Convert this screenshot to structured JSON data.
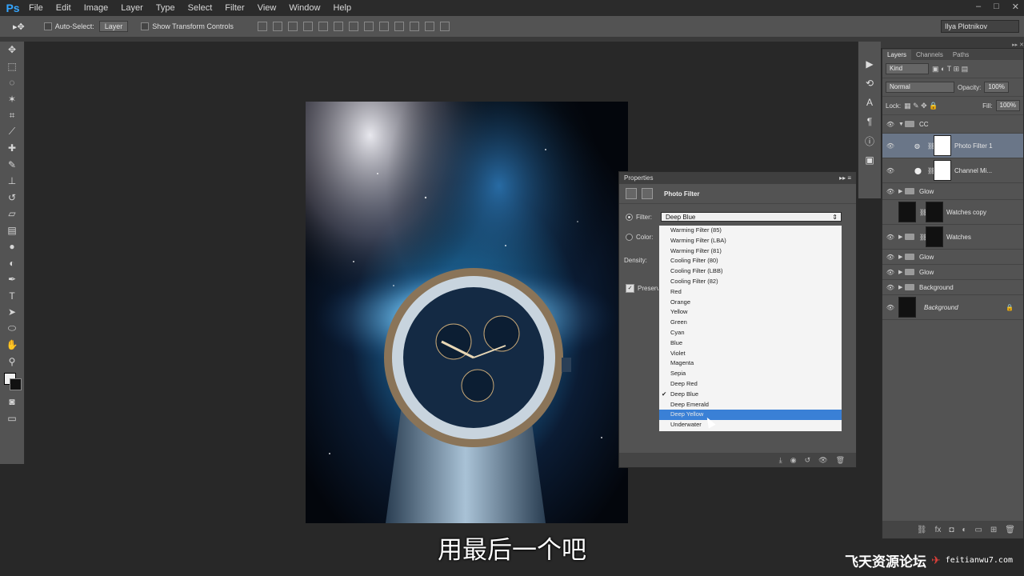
{
  "app": {
    "logo": "Ps"
  },
  "menu": [
    "File",
    "Edit",
    "Image",
    "Layer",
    "Type",
    "Select",
    "Filter",
    "View",
    "Window",
    "Help"
  ],
  "window_controls": [
    "–",
    "□",
    "✕"
  ],
  "options_bar": {
    "auto_select_label": "Auto-Select:",
    "auto_select_value": "Layer",
    "transform_label": "Show Transform Controls",
    "user": "Ilya Plotnikov"
  },
  "layers_panel": {
    "tabs": [
      "Layers",
      "Channels",
      "Paths"
    ],
    "kind": "Kind",
    "blend_mode": "Normal",
    "opacity_label": "Opacity:",
    "opacity": "100%",
    "lock_label": "Lock:",
    "fill_label": "Fill:",
    "fill": "100%",
    "layers": [
      {
        "name": "CC",
        "type": "group-open"
      },
      {
        "name": "Photo Filter 1",
        "type": "adjustment",
        "selected": true
      },
      {
        "name": "Channel Mi...",
        "type": "adjustment"
      },
      {
        "name": "Glow",
        "type": "group"
      },
      {
        "name": "Watches copy",
        "type": "layer",
        "hidden": true
      },
      {
        "name": "Watches",
        "type": "group"
      },
      {
        "name": "Glow",
        "type": "group"
      },
      {
        "name": "Glow",
        "type": "group"
      },
      {
        "name": "Background",
        "type": "group"
      },
      {
        "name": "Background",
        "type": "locked"
      }
    ]
  },
  "properties": {
    "panel_title": "Properties",
    "heading": "Photo Filter",
    "filter_label": "Filter:",
    "filter_value": "Deep Blue",
    "color_label": "Color:",
    "density_label": "Density:",
    "preserve_label": "Preserv"
  },
  "dropdown": {
    "items": [
      "Warming Filter (85)",
      "Warming Filter (LBA)",
      "Warming Filter (81)",
      "Cooling Filter (80)",
      "Cooling Filter (LBB)",
      "Cooling Filter (82)",
      "Red",
      "Orange",
      "Yellow",
      "Green",
      "Cyan",
      "Blue",
      "Violet",
      "Magenta",
      "Sepia",
      "Deep Red",
      "Deep Blue",
      "Deep Emerald",
      "Deep Yellow",
      "Underwater"
    ],
    "checked": "Deep Blue",
    "highlighted": "Deep Yellow"
  },
  "subtitle": "用最后一个吧",
  "watermark": {
    "cn": "飞天资源论坛",
    "en": "feitianwu7.com"
  },
  "colors": {
    "accent": "#35a6ff",
    "highlight": "#3a80d6"
  }
}
